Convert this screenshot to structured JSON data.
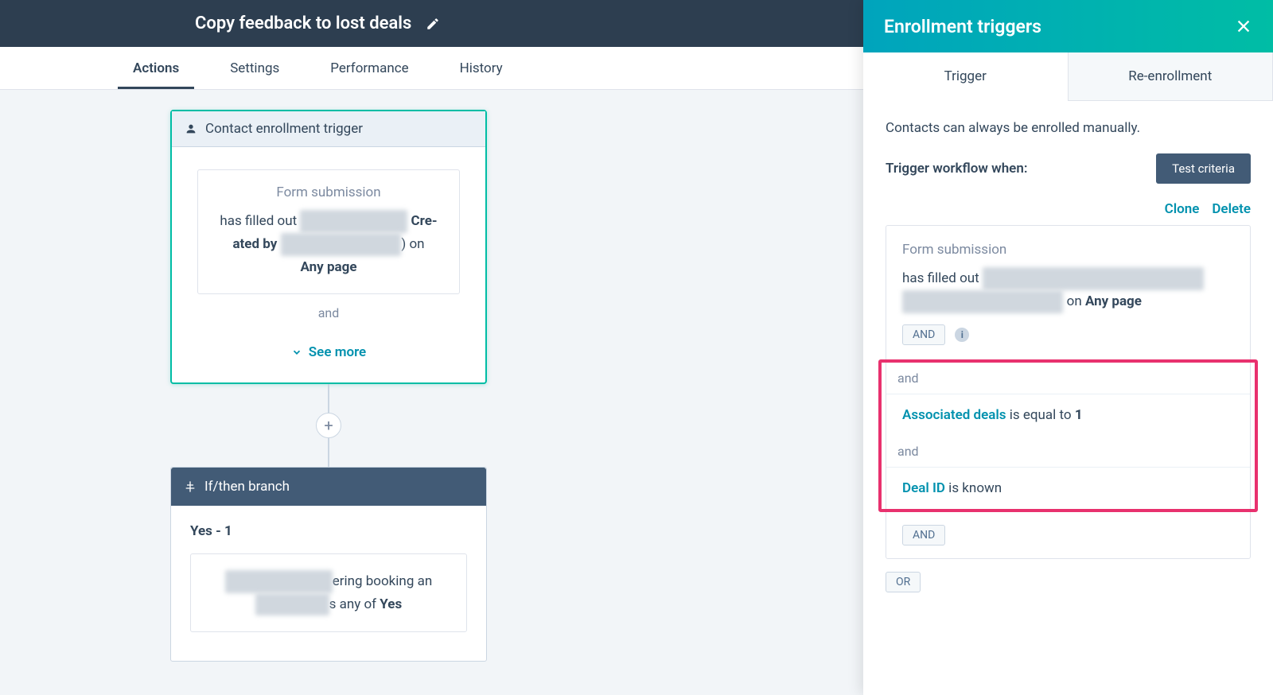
{
  "header": {
    "title": "Copy feedback to lost deals"
  },
  "tabs": [
    "Actions",
    "Settings",
    "Performance",
    "History"
  ],
  "trigger_card": {
    "title": "Contact enrollment trigger",
    "fs_label": "Form submission",
    "line_pre": "has filled out ",
    "line_mid": " Cre-ated by ",
    "line_suf": ") on",
    "any_page": "Any page",
    "and": "and",
    "see_more": "See more"
  },
  "branch_card": {
    "title": "If/then branch",
    "yes": "Yes - 1",
    "body_mid": "ering booking an",
    "body_suf": "s any of ",
    "yes_word": "Yes"
  },
  "panel": {
    "title": "Enrollment triggers",
    "tab_trigger": "Trigger",
    "tab_reenroll": "Re-enrollment",
    "manual_note": "Contacts can always be enrolled manually.",
    "trigger_when": "Trigger workflow when:",
    "test_btn": "Test criteria",
    "clone": "Clone",
    "delete": "Delete",
    "fs_label": "Form submission",
    "fs_text_pre": "has filled out ",
    "fs_text_on": " on ",
    "any_page": "Any page",
    "and_btn": "AND",
    "and_word": "and",
    "row1_prop": "Associated deals",
    "row1_rest": " is equal to ",
    "row1_val": "1",
    "row2_prop": "Deal ID",
    "row2_rest": " is known",
    "or_btn": "OR"
  }
}
